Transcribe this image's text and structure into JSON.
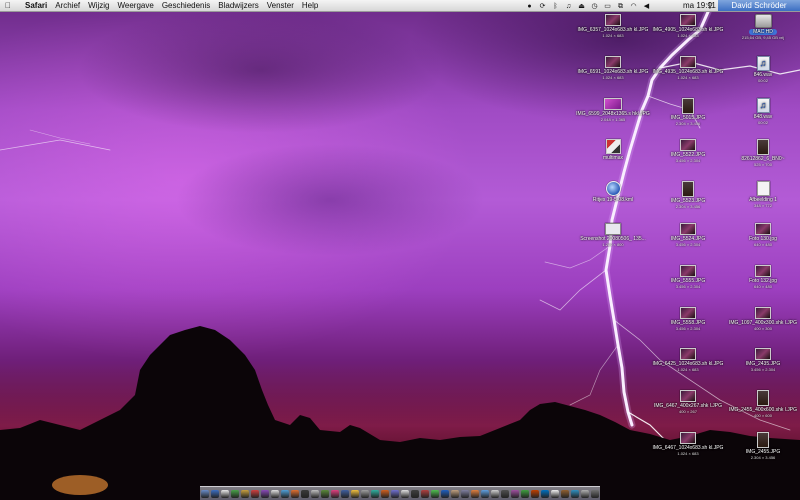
{
  "menubar": {
    "apple": "",
    "items": [
      "Safari",
      "Archief",
      "Wijzig",
      "Weergave",
      "Geschiedenis",
      "Bladwijzers",
      "Venster",
      "Help"
    ],
    "extras": [
      "record-icon",
      "sync-icon",
      "bluetooth-icon",
      "music-note-icon",
      "eject-icon",
      "time-machine-icon",
      "display-icon",
      "screen-sharing-icon",
      "wifi-icon",
      "volume-icon"
    ],
    "clock": "ma 19:11",
    "user": "David Schröder"
  },
  "desktop_icons": [
    {
      "name": "IMG_6357_1024x683.sh kl.JPG",
      "sub": "1.024 × 683",
      "type": "landscape",
      "col": 0,
      "row": 0
    },
    {
      "name": "IMG_6591_1024x683.sh kl.JPG",
      "sub": "1.024 × 683",
      "type": "landscape",
      "col": 0,
      "row": 1
    },
    {
      "name": "IMG_6599_2048x1365.s hkl.JPG",
      "sub": "2.048 × 1.365",
      "type": "pink",
      "col": 0,
      "row": 2
    },
    {
      "name": "multimax",
      "sub": "",
      "type": "mixed",
      "col": 0,
      "row": 3
    },
    {
      "name": "Ritjes 19-5-08.kml",
      "sub": "",
      "type": "globe",
      "col": 0,
      "row": 4
    },
    {
      "name": "Screenshot 20080506_ 135...",
      "sub": "1.280 × 800",
      "type": "screenshot",
      "col": 0,
      "row": 5
    },
    {
      "name": "IMG_4905_1024x683.sh kl.JPG",
      "sub": "1.024 × 683",
      "type": "landscape",
      "col": 1,
      "row": 0
    },
    {
      "name": "IMG_4935_1024x683.sh kl.JPG",
      "sub": "1.024 × 683",
      "type": "landscape",
      "col": 1,
      "row": 1
    },
    {
      "name": "IMG_5015.JPG",
      "sub": "2.304 × 3.456",
      "type": "portrait",
      "col": 1,
      "row": 2
    },
    {
      "name": "IMG_5522.JPG",
      "sub": "3.456 × 2.304",
      "type": "landscape",
      "col": 1,
      "row": 3
    },
    {
      "name": "IMG_5523.JPG",
      "sub": "2.304 × 3.456",
      "type": "portrait",
      "col": 1,
      "row": 4
    },
    {
      "name": "IMG_5524.JPG",
      "sub": "3.456 × 2.304",
      "type": "landscape",
      "col": 1,
      "row": 5
    },
    {
      "name": "IMG_5555.JPG",
      "sub": "3.456 × 2.304",
      "type": "landscape",
      "col": 1,
      "row": 6
    },
    {
      "name": "IMG_5558.JPG",
      "sub": "3.456 × 2.304",
      "type": "landscape",
      "col": 1,
      "row": 7
    },
    {
      "name": "IMG_6425_1024x683.sh kl.JPG",
      "sub": "1.024 × 683",
      "type": "landscape",
      "col": 1,
      "row": 8
    },
    {
      "name": "IMG_6467_400x267.shk l.JPG",
      "sub": "400 × 267",
      "type": "landscape",
      "col": 1,
      "row": 9
    },
    {
      "name": "IMG_6467_1024x683.sh kl.JPG",
      "sub": "1.024 × 683",
      "type": "landscape",
      "col": 1,
      "row": 10
    },
    {
      "name": "MAC HD",
      "sub": "215,64 GB, 9,45 GB vrij",
      "type": "hd",
      "col": 2,
      "row": 0,
      "highlight": true
    },
    {
      "name": "846.wav",
      "sub": "00:02",
      "type": "audio",
      "col": 2,
      "row": 1
    },
    {
      "name": "848.wav",
      "sub": "00:02",
      "type": "audio",
      "col": 2,
      "row": 2
    },
    {
      "name": "82612862_6_BN0~",
      "sub": "525 × 700",
      "type": "portrait",
      "col": 2,
      "row": 3
    },
    {
      "name": "Afbeelding 1",
      "sub": "348 × 772",
      "type": "doc",
      "col": 2,
      "row": 4
    },
    {
      "name": "Foto 130.jpg",
      "sub": "640 × 480",
      "type": "landscape",
      "col": 2,
      "row": 5
    },
    {
      "name": "Foto 132.jpg",
      "sub": "640 × 480",
      "type": "landscape",
      "col": 2,
      "row": 6
    },
    {
      "name": "IMG_1097_400x300.shk l.JPG",
      "sub": "400 × 300",
      "type": "landscape",
      "col": 2,
      "row": 7
    },
    {
      "name": "IMG_2435.JPG",
      "sub": "3.456 × 2.304",
      "type": "landscape",
      "col": 2,
      "row": 8
    },
    {
      "name": "IMG_2455_400x600.shk l.JPG",
      "sub": "400 × 600",
      "type": "portrait",
      "col": 2,
      "row": 9
    },
    {
      "name": "IMG_2455.JPG",
      "sub": "2.304 × 3.456",
      "type": "portrait",
      "col": 2,
      "row": 10
    }
  ],
  "dock": {
    "colors": [
      "#6a8cc8",
      "#3c6fc2",
      "#e9e9e9",
      "#4aa24a",
      "#c8a040",
      "#d04040",
      "#8a4ab8",
      "#e0e0e0",
      "#50a0d8",
      "#e07030",
      "#3a3a3a",
      "#c0c0c0",
      "#5a8a3a",
      "#e04080",
      "#4060a0",
      "#f0c040",
      "#a0a0a0",
      "#30b0a0",
      "#d06020",
      "#7070d0",
      "#e0e0e0",
      "#404040",
      "#b04040",
      "#50c050",
      "#2060c0",
      "#c0a080",
      "#8080a0",
      "#e08040",
      "#60a0e0",
      "#d0d0d0",
      "#505050",
      "#a050a0",
      "#40a040",
      "#c04000",
      "#0070c0",
      "#f0f0f0",
      "#906030",
      "#3090c0",
      "#b0b0b0",
      "#707070"
    ]
  }
}
